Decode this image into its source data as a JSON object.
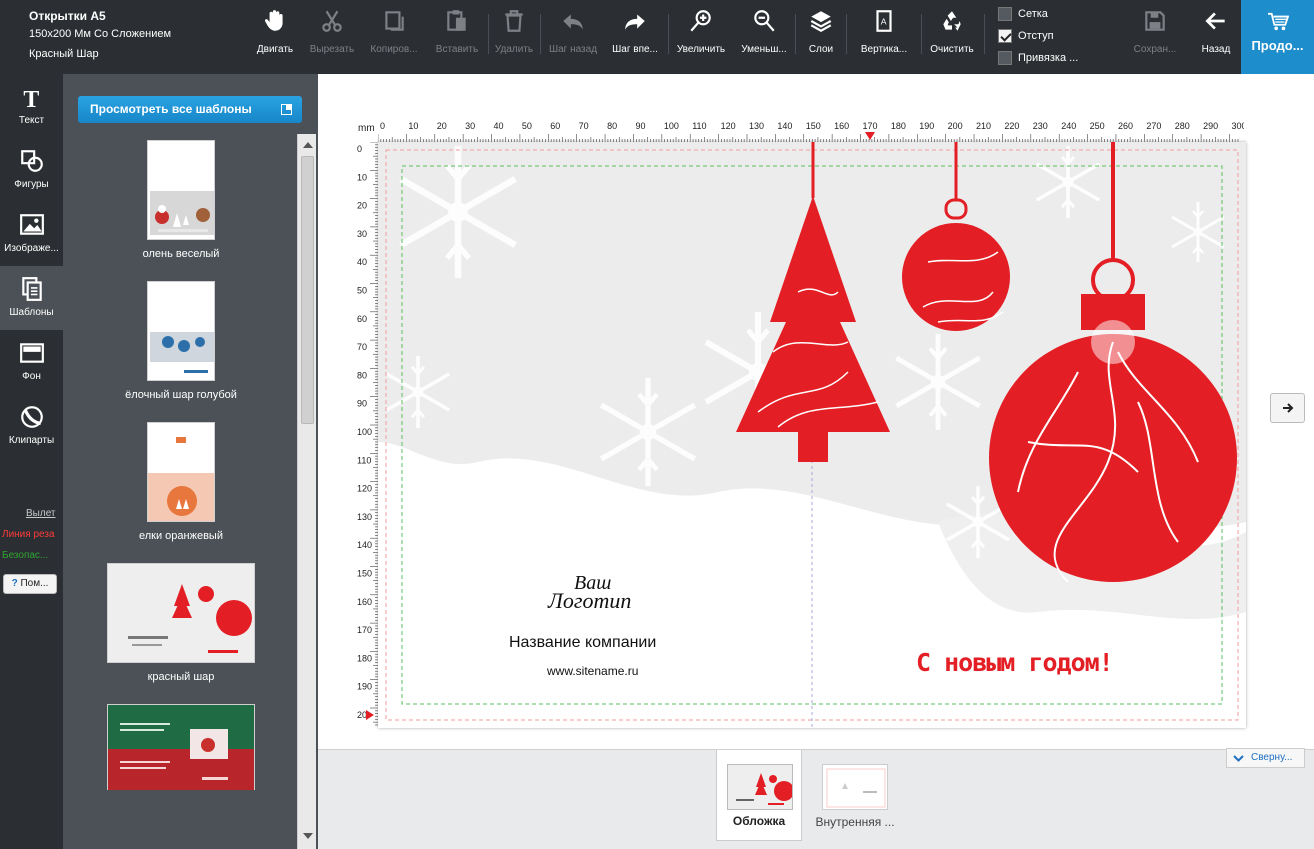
{
  "product": {
    "title": "Открытки А5",
    "size": "150x200 Мм Со Сложением",
    "design": "Красный Шар"
  },
  "toolbar": {
    "move": "Двигать",
    "cut": "Вырезать",
    "copy": "Копиров...",
    "paste": "Вставить",
    "delete": "Удалить",
    "undo": "Шаг назад",
    "redo": "Шаг впе...",
    "zoom_in": "Увеличить",
    "zoom_out": "Уменьш...",
    "layers": "Слои",
    "vertical": "Вертика...",
    "clear": "Очистить",
    "save": "Сохран...",
    "back": "Назад",
    "continue": "Продо..."
  },
  "checkboxes": [
    {
      "label": "Сетка",
      "checked": false
    },
    {
      "label": "Отступ",
      "checked": true
    },
    {
      "label": "Привязка ...",
      "checked": false
    }
  ],
  "rail": {
    "text": "Текст",
    "shapes": "Фигуры",
    "images": "Изображе...",
    "templates": "Шаблоны",
    "background": "Фон",
    "cliparts": "Клипарты"
  },
  "legend": {
    "bleed": "Вылет",
    "cut_line": "Линия реза",
    "safe": "Безопас...",
    "help": "Пом..."
  },
  "templates_panel": {
    "view_all": "Просмотреть все шаблоны",
    "items": [
      {
        "label": "олень веселый"
      },
      {
        "label": "ёлочный шар голубой"
      },
      {
        "label": "елки оранжевый"
      },
      {
        "label": "красный шар"
      }
    ]
  },
  "ruler": {
    "unit": "mm",
    "h_ticks": [
      "0",
      "10",
      "20",
      "30",
      "40",
      "50",
      "60",
      "70",
      "80",
      "90",
      "100",
      "110",
      "120",
      "130",
      "140",
      "150",
      "160",
      "170",
      "180",
      "190",
      "200",
      "210",
      "220",
      "230",
      "240",
      "250",
      "260",
      "270",
      "280",
      "290",
      "300"
    ],
    "v_ticks": [
      "0",
      "10",
      "20",
      "30",
      "40",
      "50",
      "60",
      "70",
      "80",
      "90",
      "100",
      "110",
      "120",
      "130",
      "140",
      "150",
      "160",
      "170",
      "180",
      "190",
      "20"
    ]
  },
  "card": {
    "logo_line1": "Ваш",
    "logo_line2": "Логотип",
    "company": "Название компании",
    "site": "www.sitename.ru",
    "greeting": "С новым годом!"
  },
  "pages": {
    "cover": "Обложка",
    "inner": "Внутренняя ...",
    "collapse": "Сверну..."
  },
  "colors": {
    "accent": "#1e8dcc",
    "red": "#e31e24",
    "toolbar_bg": "#2b2f33"
  }
}
